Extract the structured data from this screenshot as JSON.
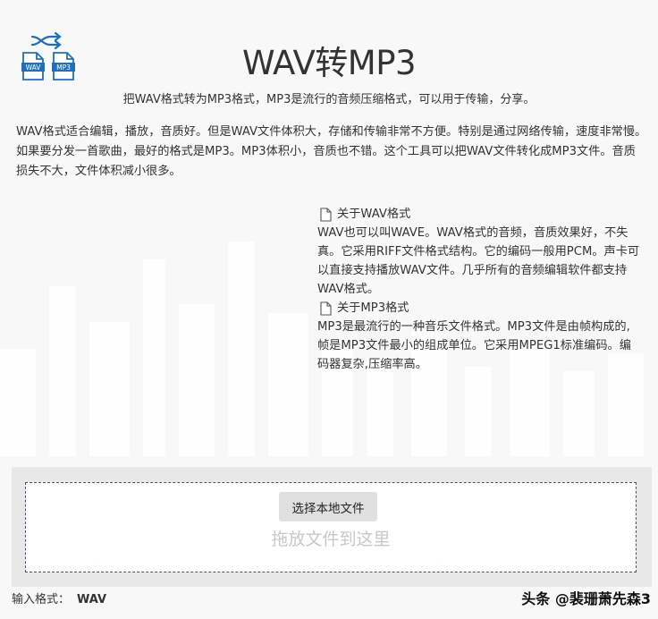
{
  "header": {
    "title": "WAV转MP3",
    "subtitle": "把WAV格式转为MP3格式，MP3是流行的音频压缩格式，可以用于传输，分享。",
    "logo": {
      "icon": "shuffle-icon",
      "left_label": "WAV",
      "right_label": "MP3"
    }
  },
  "intro": "WAV格式适合编辑，播放，音质好。但是WAV文件体积大，存储和传输非常不方便。特别是通过网络传输，速度非常慢。如果要分发一首歌曲，最好的格式是MP3。MP3体积小，音质也不错。这个工具可以把WAV文件转化成MP3文件。音质损失不大，文件体积减小很多。",
  "info": [
    {
      "icon": "document-icon",
      "heading": "关于WAV格式",
      "body": "WAV也可以叫WAVE。WAV格式的音频，音质效果好，不失真。它采用RIFF文件格式结构。它的编码一般用PCM。声卡可以直接支持播放WAV文件。几乎所有的音频编辑软件都支持WAV格式。"
    },
    {
      "icon": "document-icon",
      "heading": "关于MP3格式",
      "body": "MP3是最流行的一种音乐文件格式。MP3文件是由帧构成的,帧是MP3文件最小的组成单位。它采用MPEG1标准编码。编码器复杂,压缩率高。"
    }
  ],
  "upload": {
    "button_label": "选择本地文件",
    "drop_hint": "拖放文件到这里"
  },
  "footer": {
    "input_format_label": "输入格式：",
    "input_format_value": "WAV"
  },
  "watermark": "头条 @裴珊萧先森3",
  "colors": {
    "accent": "#1e6fc2",
    "drop_border": "#4a4a8c"
  }
}
